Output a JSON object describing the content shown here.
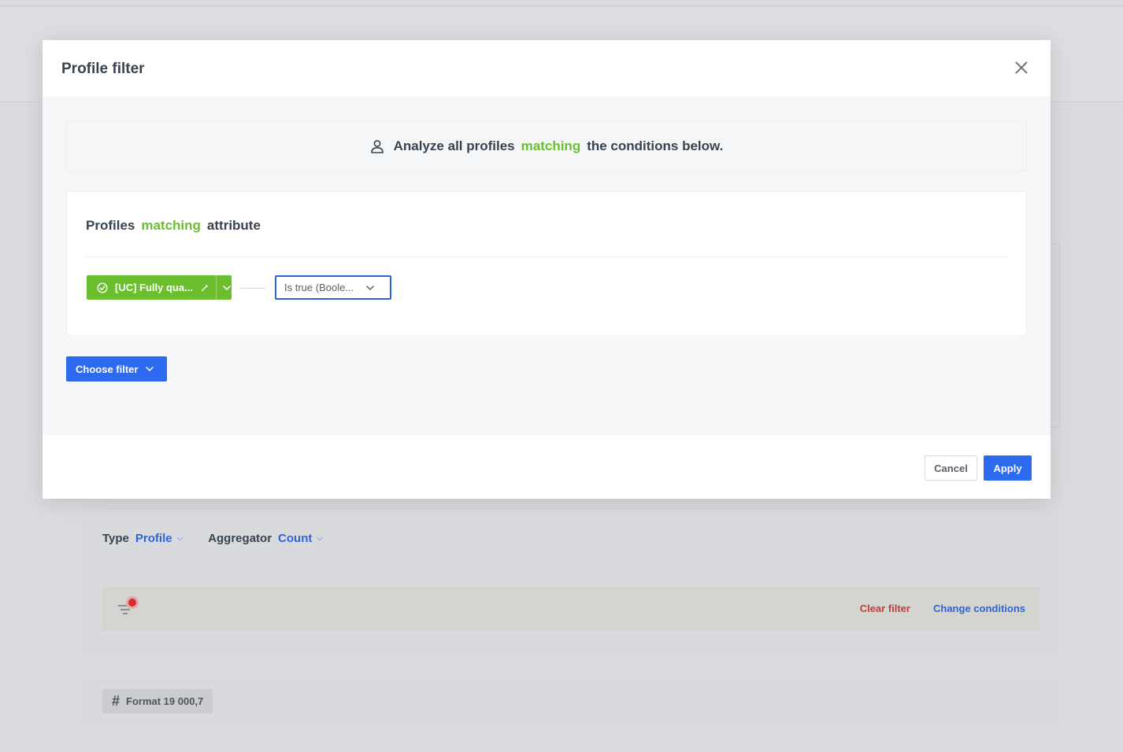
{
  "background": {
    "type_label": "Type",
    "type_value": "Profile",
    "aggregator_label": "Aggregator",
    "aggregator_value": "Count",
    "clear_filter": "Clear filter",
    "change_conditions": "Change conditions",
    "format_badge": "Format 19 000,7",
    "filter_active_color": "#d22c2c"
  },
  "modal": {
    "title": "Profile filter",
    "banner": {
      "prefix": "Analyze all profiles",
      "highlight": "matching",
      "suffix": "the conditions below."
    },
    "condition": {
      "title_prefix": "Profiles",
      "title_highlight": "matching",
      "title_suffix": "attribute",
      "attribute_label": "[UC] Fully qua...",
      "operator_label": "Is true (Boole..."
    },
    "choose_filter_label": "Choose filter",
    "footer": {
      "cancel_label": "Cancel",
      "apply_label": "Apply"
    }
  },
  "colors": {
    "accent": "#2d6af0",
    "highlight_green": "#6bbf2f",
    "danger": "#c33b3b"
  },
  "icons": {
    "close": "close-icon",
    "user": "user-icon",
    "attribute": "attribute-icon",
    "edit": "pencil-icon",
    "chevron": "chevron-down-icon",
    "filter": "filter-icon",
    "hash": "hash-icon"
  }
}
